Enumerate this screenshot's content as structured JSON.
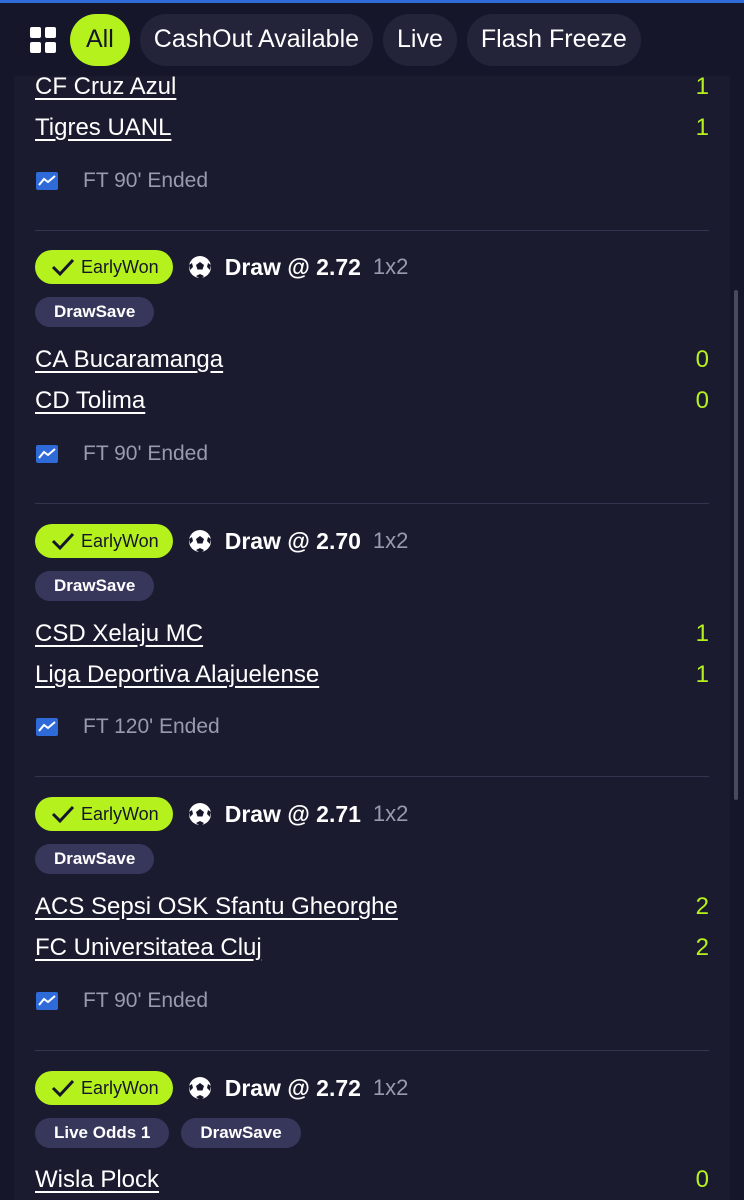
{
  "filters": {
    "grid_icon": "grid-icon",
    "chips": [
      "All",
      "CashOut Available",
      "Live",
      "Flash Freeze"
    ],
    "active": "All"
  },
  "colors": {
    "accent": "#b5f21d",
    "background": "#16162a",
    "panel": "#1b1b30",
    "tag": "#37375c",
    "muted": "#9a9aae"
  },
  "bets": [
    {
      "partial": true,
      "home": "CF Cruz Azul",
      "home_score": "1",
      "away": "Tigres UANL",
      "away_score": "1",
      "status": "FT 90' Ended"
    },
    {
      "badge": "EarlyWon",
      "selection": "Draw @ 2.72",
      "market": "1x2",
      "tags": [
        "DrawSave"
      ],
      "home": "CA Bucaramanga",
      "home_score": "0",
      "away": "CD Tolima",
      "away_score": "0",
      "status": "FT 90' Ended"
    },
    {
      "badge": "EarlyWon",
      "selection": "Draw @ 2.70",
      "market": "1x2",
      "tags": [
        "DrawSave"
      ],
      "home": "CSD Xelaju MC",
      "home_score": "1",
      "away": "Liga Deportiva Alajuelense",
      "away_score": "1",
      "status": "FT 120' Ended"
    },
    {
      "badge": "EarlyWon",
      "selection": "Draw @ 2.71",
      "market": "1x2",
      "tags": [
        "DrawSave"
      ],
      "home": "ACS Sepsi OSK Sfantu Gheorghe",
      "home_score": "2",
      "away": "FC Universitatea Cluj",
      "away_score": "2",
      "status": "FT 90' Ended"
    },
    {
      "badge": "EarlyWon",
      "selection": "Draw @ 2.72",
      "market": "1x2",
      "tags": [
        "Live Odds 1",
        "DrawSave"
      ],
      "home": "Wisla Plock",
      "home_score": "0"
    }
  ]
}
